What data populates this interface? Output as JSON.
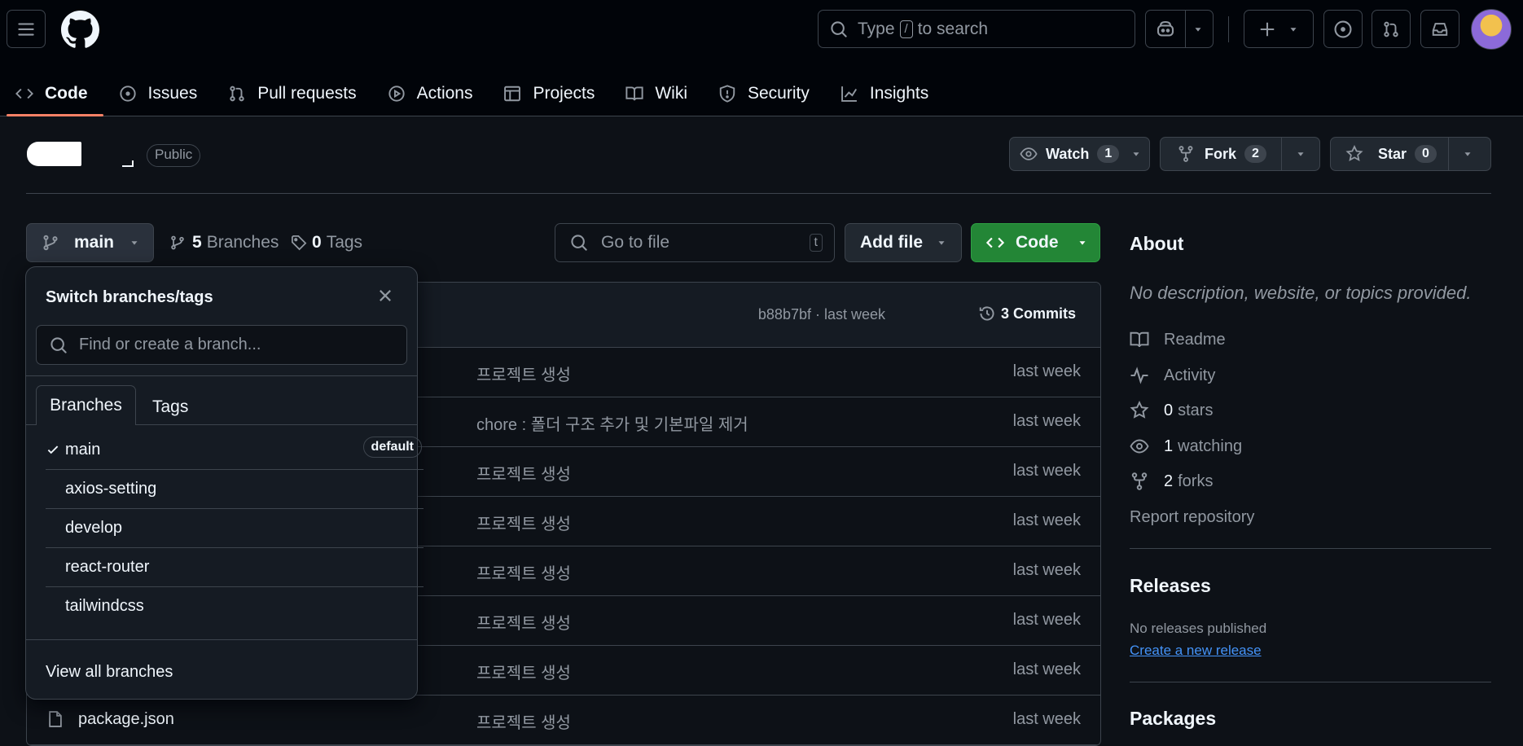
{
  "header": {
    "search_placeholder_pre": "Type",
    "search_key": "/",
    "search_placeholder_post": "to search"
  },
  "tabs": [
    {
      "label": "Code",
      "icon": "code-icon"
    },
    {
      "label": "Issues",
      "icon": "issue-icon"
    },
    {
      "label": "Pull requests",
      "icon": "pull-request-icon"
    },
    {
      "label": "Actions",
      "icon": "play-icon"
    },
    {
      "label": "Projects",
      "icon": "table-icon"
    },
    {
      "label": "Wiki",
      "icon": "book-icon"
    },
    {
      "label": "Security",
      "icon": "shield-icon"
    },
    {
      "label": "Insights",
      "icon": "graph-icon"
    }
  ],
  "repo": {
    "visibility": "Public",
    "watch_label": "Watch",
    "watch_count": "1",
    "fork_label": "Fork",
    "fork_count": "2",
    "star_label": "Star",
    "star_count": "0"
  },
  "toolbar": {
    "branch": "main",
    "branches_count": "5",
    "branches_label": "Branches",
    "tags_count": "0",
    "tags_label": "Tags",
    "goto_placeholder": "Go to file",
    "goto_key": "t",
    "add_file": "Add file",
    "code": "Code"
  },
  "commit_bar": {
    "hash": "b88b7bf · last week",
    "commits": "3 Commits"
  },
  "files": [
    {
      "name": "",
      "message": "프로젝트 생성",
      "date": "last week"
    },
    {
      "name": "",
      "message": "chore : 폴더 구조 추가 및 기본파일 제거",
      "date": "last week"
    },
    {
      "name": "",
      "message": "프로젝트 생성",
      "date": "last week"
    },
    {
      "name": "",
      "message": "프로젝트 생성",
      "date": "last week"
    },
    {
      "name": "",
      "message": "프로젝트 생성",
      "date": "last week"
    },
    {
      "name": "",
      "message": "프로젝트 생성",
      "date": "last week"
    },
    {
      "name": "",
      "message": "프로젝트 생성",
      "date": "last week"
    },
    {
      "name": "package.json",
      "message": "프로젝트 생성",
      "date": "last week"
    }
  ],
  "dropdown": {
    "title": "Switch branches/tags",
    "filter_placeholder": "Find or create a branch...",
    "tab_branches": "Branches",
    "tab_tags": "Tags",
    "branches": [
      "main",
      "axios-setting",
      "develop",
      "react-router",
      "tailwindcss"
    ],
    "default_badge": "default",
    "view_all": "View all branches"
  },
  "about": {
    "title": "About",
    "description": "No description, website, or topics provided.",
    "readme": "Readme",
    "activity": "Activity",
    "stars_count": "0",
    "stars_label": "stars",
    "watching_count": "1",
    "watching_label": "watching",
    "forks_count": "2",
    "forks_label": "forks",
    "report": "Report repository"
  },
  "releases": {
    "title": "Releases",
    "none": "No releases published",
    "create": "Create a new release"
  },
  "packages": {
    "title": "Packages"
  },
  "colors": {
    "accent": "#f78166",
    "green": "#238636",
    "link": "#4493f8"
  }
}
